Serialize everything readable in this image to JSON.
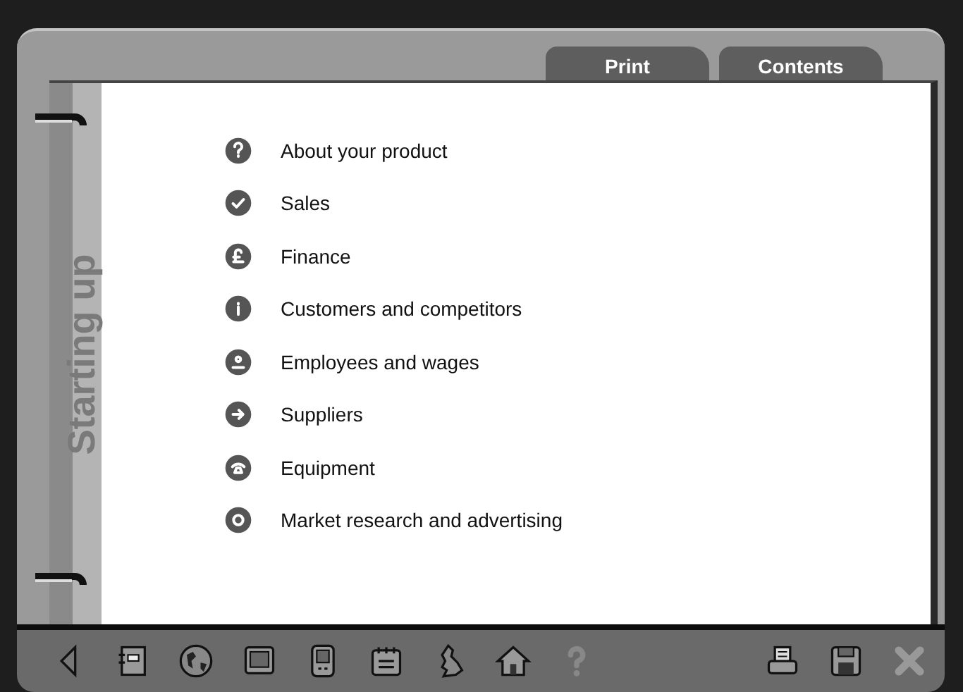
{
  "tabs": [
    {
      "label": "Print"
    },
    {
      "label": "Contents"
    }
  ],
  "section_title": "Starting up",
  "menu": [
    {
      "label": "About your product"
    },
    {
      "label": "Sales"
    },
    {
      "label": "Finance"
    },
    {
      "label": "Customers and competitors"
    },
    {
      "label": "Employees and wages"
    },
    {
      "label": "Suppliers"
    },
    {
      "label": "Equipment"
    },
    {
      "label": "Market research and advertising"
    }
  ]
}
